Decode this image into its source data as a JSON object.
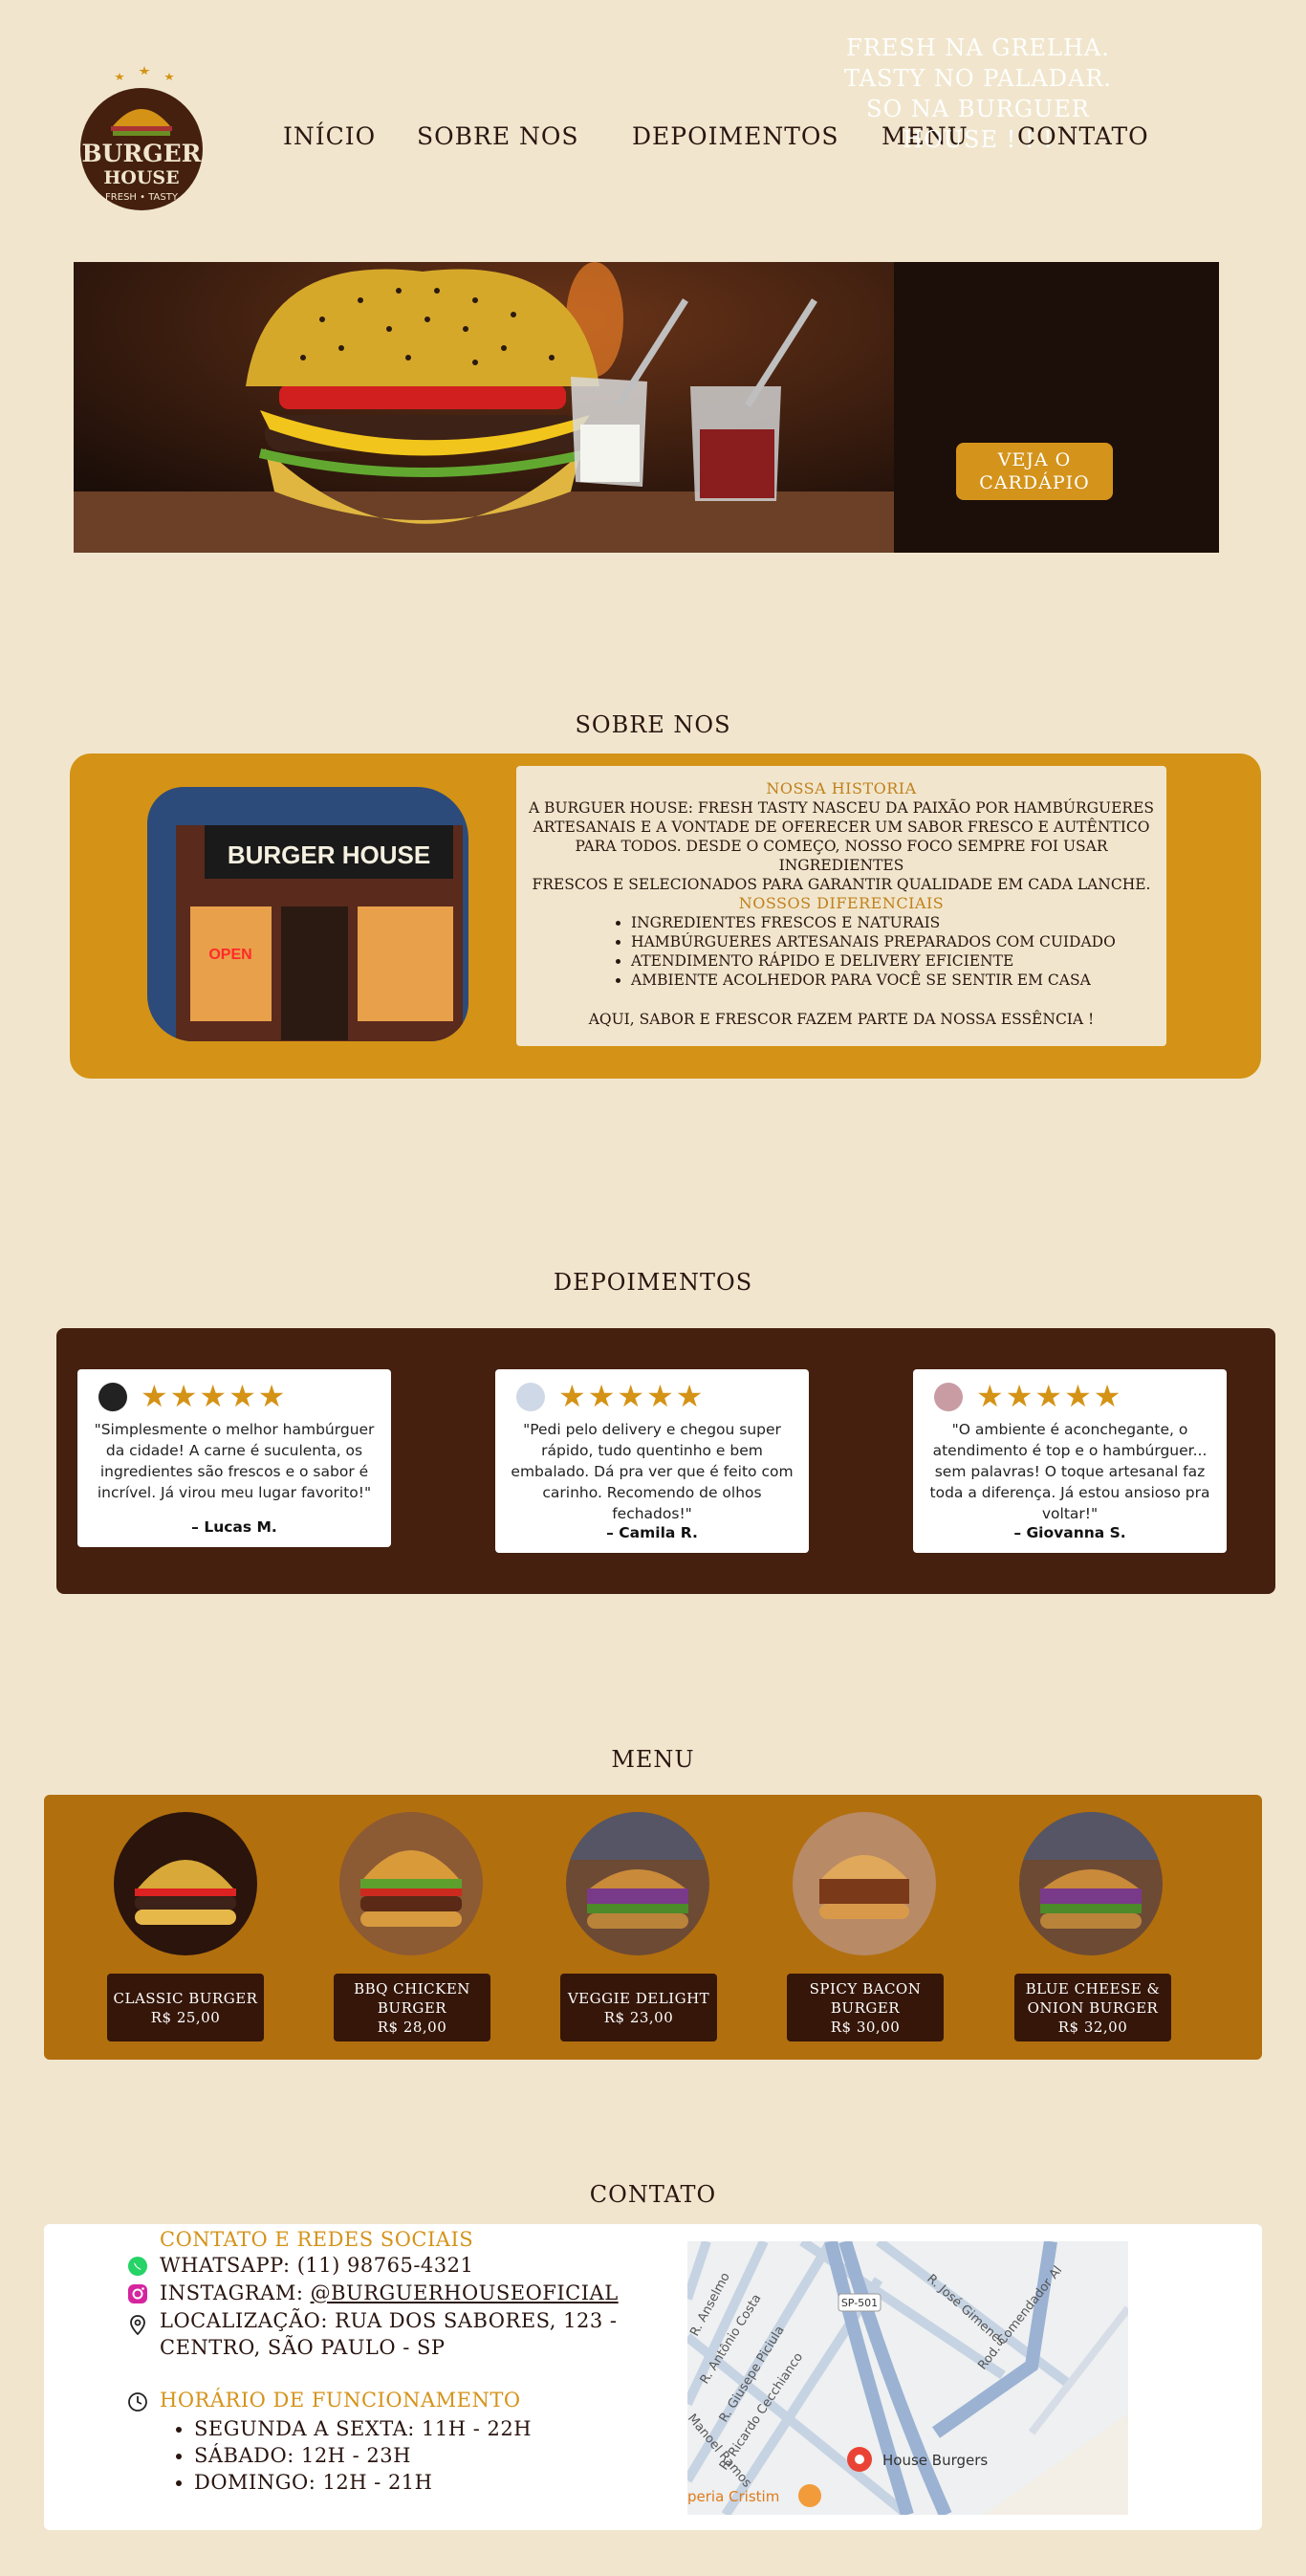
{
  "brand": {
    "logo_top": "BURGER",
    "logo_bottom": "HOUSE",
    "logo_tagline": "FRESH • TASTY",
    "colors": {
      "background": "#f1e6cd",
      "accent": "#d49316",
      "dark": "#45200f",
      "menu": "#b26f0e"
    }
  },
  "nav": {
    "items": [
      {
        "label": "INÍCIO"
      },
      {
        "label": "SOBRE NOS"
      },
      {
        "label": "DEPOIMENTOS"
      },
      {
        "label": "MENU"
      },
      {
        "label": "CONTATO"
      }
    ]
  },
  "hero": {
    "lines": [
      "FRESH NA GRELHA.",
      "TASTY NO PALADAR.",
      "SO NA BURGUER",
      "HOUSE ! ! !"
    ],
    "button_lines": [
      "VEJA O",
      "CARDÁPIO"
    ]
  },
  "sobre": {
    "title": "SOBRE NOS",
    "storefront_sign": "BURGER HOUSE",
    "storefront_open": "OPEN",
    "history_heading": "NOSSA HISTORIA",
    "history_lines": [
      "A BURGUER HOUSE: FRESH TASTY NASCEU DA PAIXÃO POR HAMBÚRGUERES",
      "ARTESANAIS E A VONTADE DE OFERECER UM SABOR FRESCO E AUTÊNTICO",
      "PARA TODOS. DESDE O COMEÇO, NOSSO FOCO SEMPRE FOI USAR INGREDIENTES",
      "FRESCOS E SELECIONADOS PARA GARANTIR QUALIDADE EM CADA LANCHE."
    ],
    "diff_heading": "NOSSOS DIFERENCIAIS",
    "diff_items": [
      "INGREDIENTES FRESCOS E NATURAIS",
      "HAMBÚRGUERES ARTESANAIS PREPARADOS COM CUIDADO",
      "ATENDIMENTO RÁPIDO E DELIVERY EFICIENTE",
      "AMBIENTE ACOLHEDOR PARA VOCÊ SE SENTIR EM CASA"
    ],
    "closing": "AQUI, SABOR E FRESCOR FAZEM PARTE DA NOSSA ESSÊNCIA !"
  },
  "depoimentos": {
    "title": "DEPOIMENTOS",
    "items": [
      {
        "stars": "★★★★★",
        "text": "\"Simplesmente o melhor hambúrguer da cidade! A carne é suculenta, os ingredientes são frescos e o sabor é incrível. Já virou meu lugar favorito!\"",
        "author": "– Lucas M."
      },
      {
        "stars": "★★★★★",
        "text": "\"Pedi pelo delivery e chegou super rápido, tudo quentinho e bem embalado. Dá pra ver que é feito com carinho. Recomendo de olhos fechados!\"",
        "author": "– Camila R."
      },
      {
        "stars": "★★★★★",
        "text": "\"O ambiente é aconchegante, o atendimento é top e o hambúrguer... sem palavras! O toque artesanal faz toda a diferença. Já estou ansioso pra voltar!\"",
        "author": "– Giovanna S."
      }
    ]
  },
  "menu": {
    "title": "MENU",
    "items": [
      {
        "name": "CLASSIC BURGER",
        "price": "R$ 25,00"
      },
      {
        "name": "BBQ CHICKEN BURGER",
        "price": "R$ 28,00"
      },
      {
        "name": "VEGGIE DELIGHT",
        "price": "R$ 23,00"
      },
      {
        "name": "SPICY BACON BURGER",
        "price": "R$ 30,00"
      },
      {
        "name": "BLUE CHEESE & ONION BURGER",
        "price": "R$ 32,00"
      }
    ]
  },
  "contato": {
    "title": "CONTATO",
    "social_heading": "CONTATO E REDES SOCIAIS",
    "whatsapp": "WHATSAPP: (11) 98765-4321",
    "instagram_prefix": "INSTAGRAM: ",
    "instagram_handle": "@BURGUERHOUSEOFICIAL",
    "location_line1": "LOCALIZAÇÃO: RUA DOS SABORES, 123 -",
    "location_line2": "CENTRO, SÃO PAULO - SP",
    "hours_heading": "HORÁRIO DE FUNCIONAMENTO",
    "hours": [
      "SEGUNDA A SEXTA: 11H - 22H",
      "SÁBADO: 12H - 23H",
      "DOMINGO: 12H - 21H"
    ],
    "map": {
      "streets": [
        "R. Anselmo",
        "R. Antônio Costa",
        "R. Giusepe Piciula",
        "R. Ricardo Cecchianco",
        "Manoel Ramos",
        "R. José Gimenes",
        "Rod. Comendador Al"
      ],
      "road_shield": "SP-501",
      "place_main": "House Burgers",
      "place_other": "peria Cristim"
    }
  }
}
